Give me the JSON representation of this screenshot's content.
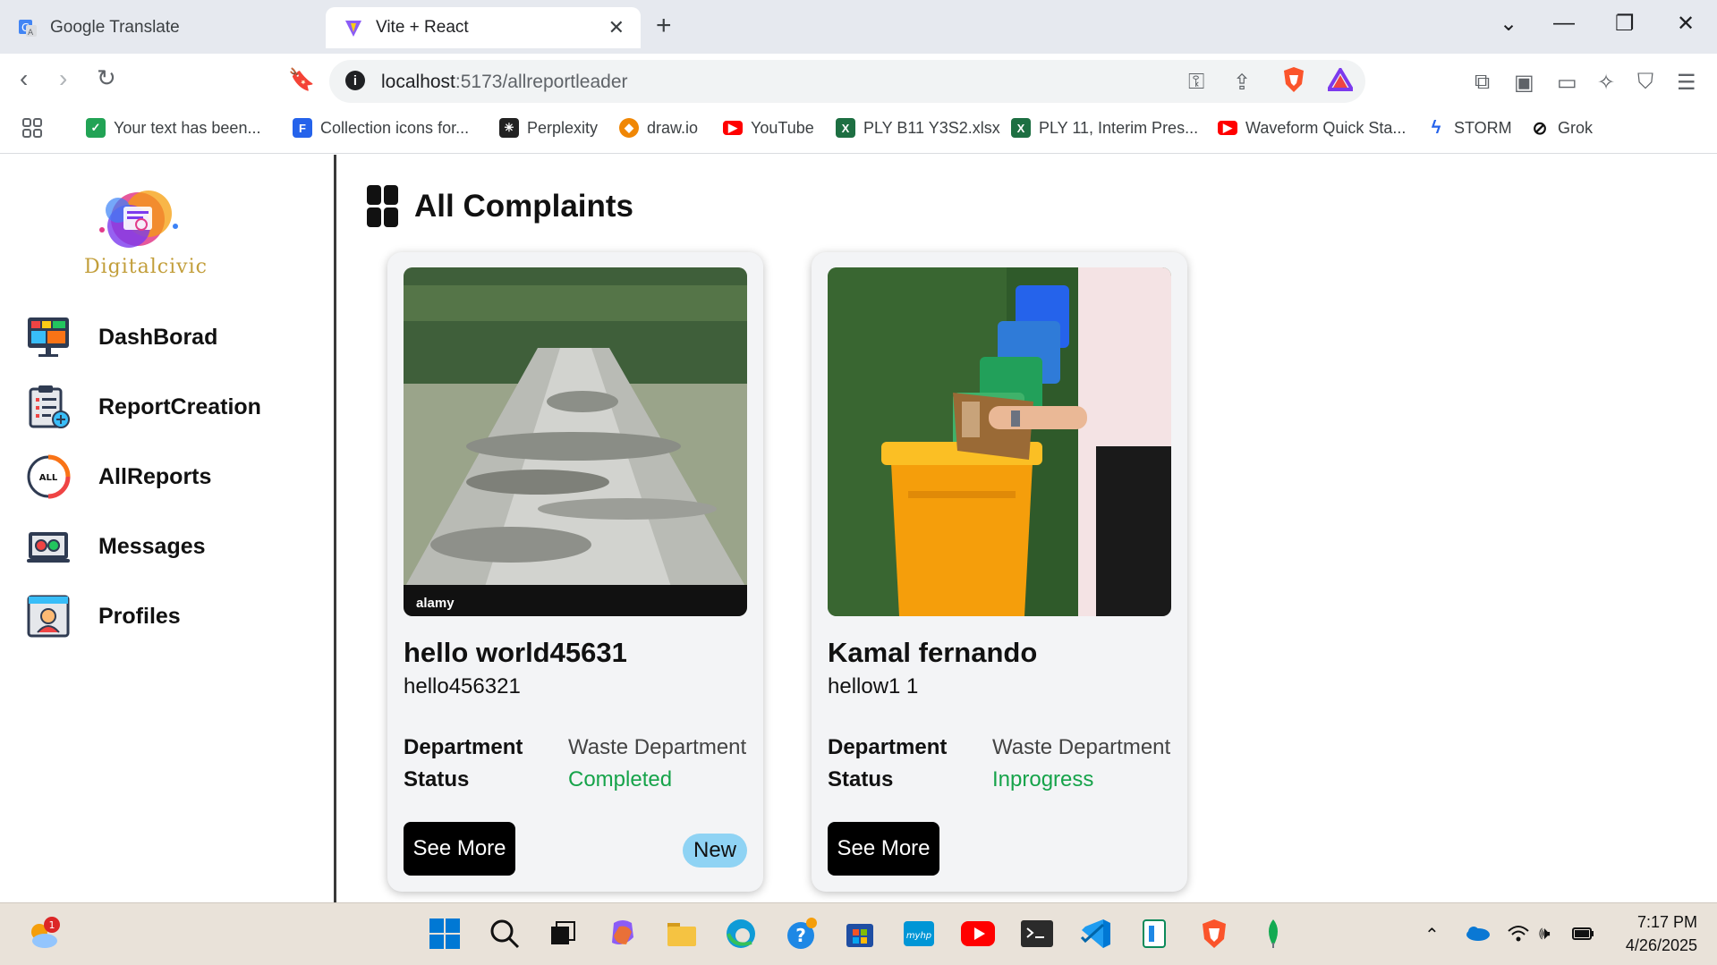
{
  "browser": {
    "tabs": [
      {
        "label": "Google Translate",
        "active": false
      },
      {
        "label": "Vite + React",
        "active": true
      }
    ],
    "url_host": "localhost",
    "url_rest": ":5173/allreportleader",
    "bookmarks": [
      {
        "label": "Your text has been...",
        "icon": "checkbox-icon"
      },
      {
        "label": "Collection icons for...",
        "icon": "flaticon-icon"
      },
      {
        "label": "Perplexity",
        "icon": "perplexity-icon"
      },
      {
        "label": "draw.io",
        "icon": "drawio-icon"
      },
      {
        "label": "YouTube",
        "icon": "youtube-icon"
      },
      {
        "label": "PLY B11 Y3S2.xlsx",
        "icon": "excel-icon"
      },
      {
        "label": "PLY 11, Interim Pres...",
        "icon": "excel-icon"
      },
      {
        "label": "Waveform Quick Sta...",
        "icon": "youtube-icon"
      },
      {
        "label": "STORM",
        "icon": "storm-icon"
      },
      {
        "label": "Grok",
        "icon": "grok-icon"
      }
    ]
  },
  "app": {
    "brand": "Digitalcivic",
    "nav": [
      {
        "label": "DashBorad",
        "icon": "dashboard-icon"
      },
      {
        "label": "ReportCreation",
        "icon": "report-creation-icon"
      },
      {
        "label": "AllReports",
        "icon": "all-reports-icon",
        "icon_text": "ALL"
      },
      {
        "label": "Messages",
        "icon": "messages-icon"
      },
      {
        "label": "Profiles",
        "icon": "profiles-icon"
      }
    ],
    "page_title": "All Complaints",
    "labels": {
      "department": "Department",
      "status": "Status",
      "see_more": "See More"
    },
    "complaints": [
      {
        "title": "hello world45631",
        "description": "hello456321",
        "department": "Waste Department",
        "status": "Completed",
        "badge": "New",
        "image": "damaged-road-photo",
        "watermark": "alamy"
      },
      {
        "title": "Kamal fernando",
        "description": "hellow1 1",
        "department": "Waste Department",
        "status": "Inprogress",
        "badge": "",
        "image": "waste-bin-photo"
      }
    ],
    "colors": {
      "status": "#16a34a",
      "badge": "#8fd3f4",
      "button": "#000000",
      "card": "#f3f4f6"
    }
  },
  "taskbar": {
    "time": "7:17 PM",
    "date": "4/26/2025",
    "weather_badge": "1"
  }
}
